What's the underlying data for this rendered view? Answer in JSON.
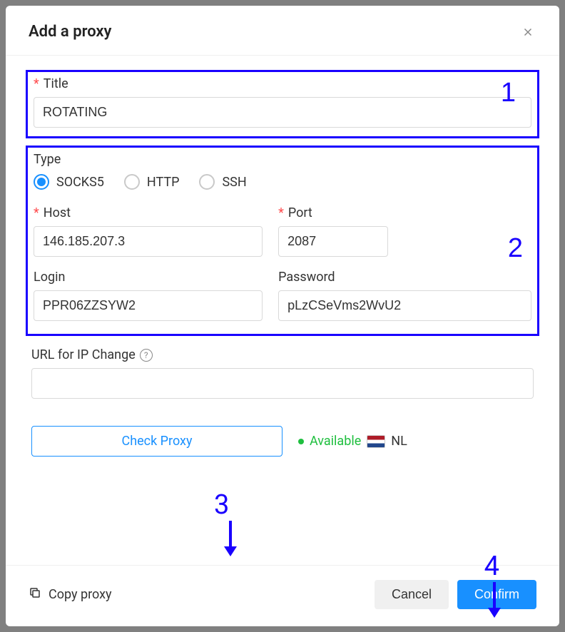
{
  "header": {
    "title": "Add a proxy"
  },
  "title_field": {
    "label": "Title",
    "value": "ROTATING"
  },
  "type_section": {
    "label": "Type",
    "options": [
      "SOCKS5",
      "HTTP",
      "SSH"
    ],
    "selected": "SOCKS5"
  },
  "host": {
    "label": "Host",
    "value": "146.185.207.3"
  },
  "port": {
    "label": "Port",
    "value": "2087"
  },
  "login": {
    "label": "Login",
    "value": "PPR06ZZSYW2"
  },
  "password": {
    "label": "Password",
    "value": "pLzCSeVms2WvU2"
  },
  "url_change": {
    "label": "URL for IP Change",
    "value": ""
  },
  "check_proxy": {
    "button_label": "Check Proxy",
    "status_text": "Available",
    "country_code": "NL"
  },
  "footer": {
    "copy_label": "Copy proxy",
    "cancel_label": "Cancel",
    "confirm_label": "Confirm"
  },
  "annotations": {
    "a1": "1",
    "a2": "2",
    "a3": "3",
    "a4": "4"
  }
}
